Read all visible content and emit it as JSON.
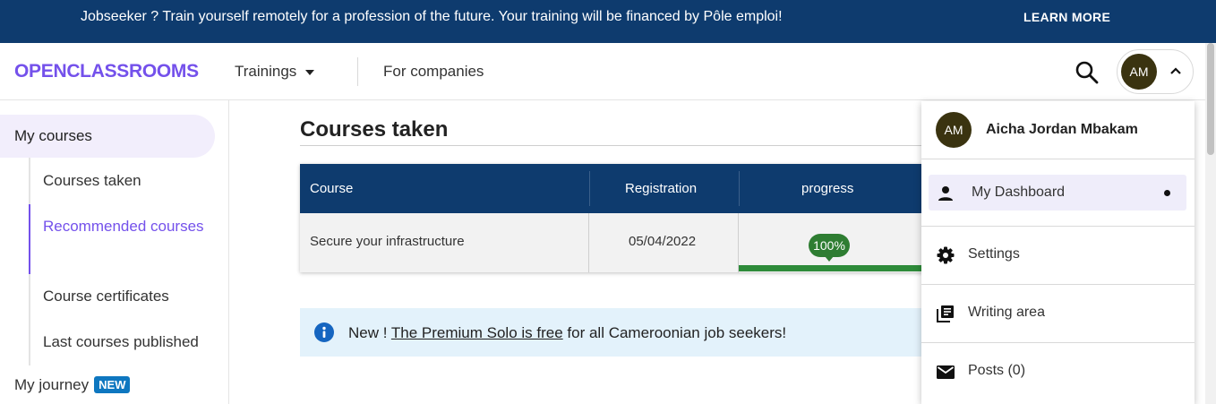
{
  "banner": {
    "text": "Jobseeker ? Train yourself remotely for a profession of the future. Your training will be financed by Pôle emploi!",
    "link": "LEARN MORE"
  },
  "header": {
    "logo": "OPENCLASSROOMS",
    "nav_trainings": "Trainings",
    "nav_companies": "For companies",
    "avatar_initials": "AM"
  },
  "sidebar": {
    "my_courses": "My courses",
    "items": [
      {
        "label": "Courses taken"
      },
      {
        "label": "Recommended courses"
      },
      {
        "label": "Course certificates"
      },
      {
        "label": "Last courses published"
      }
    ],
    "journey": "My journey",
    "journey_badge": "NEW"
  },
  "main": {
    "title": "Courses taken",
    "table": {
      "headers": [
        "Course",
        "Registration",
        "progress"
      ],
      "rows": [
        {
          "course": "Secure your infrastructure",
          "registration": "05/04/2022",
          "progress_label": "100%",
          "progress": 1.0
        }
      ]
    },
    "info": {
      "prefix": "New ! ",
      "link": "The Premium Solo is free",
      "suffix": " for all Cameroonian job seekers!"
    }
  },
  "dropdown": {
    "initials": "AM",
    "name": "Aicha Jordan Mbakam",
    "items": [
      {
        "label": "My Dashboard",
        "icon": "person-icon"
      },
      {
        "label": "Settings",
        "icon": "gear-icon"
      },
      {
        "label": "Writing area",
        "icon": "library-books-icon"
      },
      {
        "label": "Posts (0)",
        "icon": "mail-icon"
      }
    ]
  },
  "colors": {
    "banner": "#0e3b6e",
    "brand": "#7451eb",
    "progress": "#2e7d32",
    "info_bg": "#e3f2fb"
  }
}
